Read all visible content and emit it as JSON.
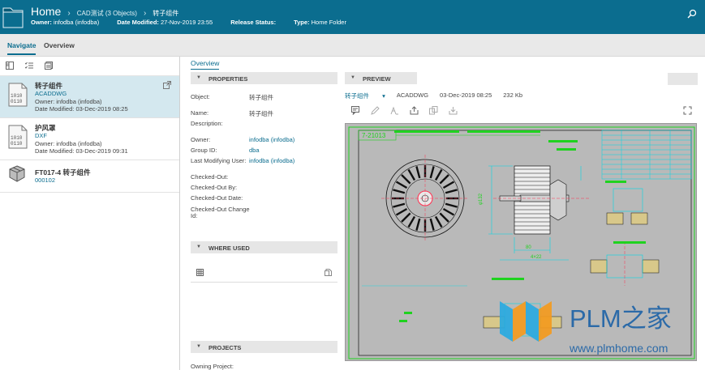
{
  "header": {
    "home": "Home",
    "crumb1": "CAD测试 (3 Objects)",
    "crumb2": "转子组件",
    "owner_label": "Owner:",
    "owner_value": "infodba (infodba)",
    "modified_label": "Date Modified:",
    "modified_value": "27-Nov-2019 23:55",
    "release_label": "Release Status:",
    "release_value": "",
    "type_label": "Type:",
    "type_value": "Home Folder"
  },
  "tabs": {
    "navigate": "Navigate",
    "overview": "Overview"
  },
  "objects": [
    {
      "name": "转子组件",
      "type": "ACADDWG",
      "line1": "Owner:  infodba (infodba)",
      "line2": "Date Modified:  03-Dec-2019 08:25",
      "icon": "binary-file-icon"
    },
    {
      "name": "护风罩",
      "type": "DXF",
      "line1": "Owner:  infodba (infodba)",
      "line2": "Date Modified:  03-Dec-2019 09:31",
      "icon": "binary-file-icon"
    },
    {
      "name": "FT017-4 转子组件",
      "type": "000102",
      "icon": "item-cubes-icon"
    }
  ],
  "overview_tab": "Overview",
  "properties": {
    "header": "PROPERTIES",
    "object_label": "Object:",
    "object_value": "转子组件",
    "name_label": "Name:",
    "name_value": "转子组件",
    "description_label": "Description:",
    "owner_label": "Owner:",
    "owner_value": "infodba (infodba)",
    "group_label": "Group ID:",
    "group_value": "dba",
    "lastmod_label": "Last Modifying User:",
    "lastmod_value": "infodba (infodba)",
    "checkedout_label": "Checked-Out:",
    "checkedoutby_label": "Checked-Out By:",
    "checkedoutdate_label": "Checked-Out Date:",
    "checkedoutchange_label1": "Checked-Out Change",
    "checkedoutchange_label2": "Id:"
  },
  "where_used": {
    "header": "WHERE USED"
  },
  "projects": {
    "header": "PROJECTS",
    "owning_label": "Owning Project:"
  },
  "preview": {
    "header": "PREVIEW",
    "file_name": "转子组件",
    "file_type": "ACADDWG",
    "file_date": "03-Dec-2019 08:25",
    "file_size": "232 Kb"
  },
  "drawing": {
    "title_block_text": "7-21013",
    "dims": [
      "φ132",
      "φ48",
      "φ30",
      "φ22",
      "4×22",
      "80"
    ]
  },
  "watermark": {
    "brand": "PLM之家",
    "url": "www.plmhome.com"
  },
  "colors": {
    "header_bg": "#0b6d8f",
    "accent": "#0b6d8f",
    "selection": "#d4e8ef",
    "drawing_green": "#1fd21f",
    "drawing_cyan": "#00d8e6"
  }
}
